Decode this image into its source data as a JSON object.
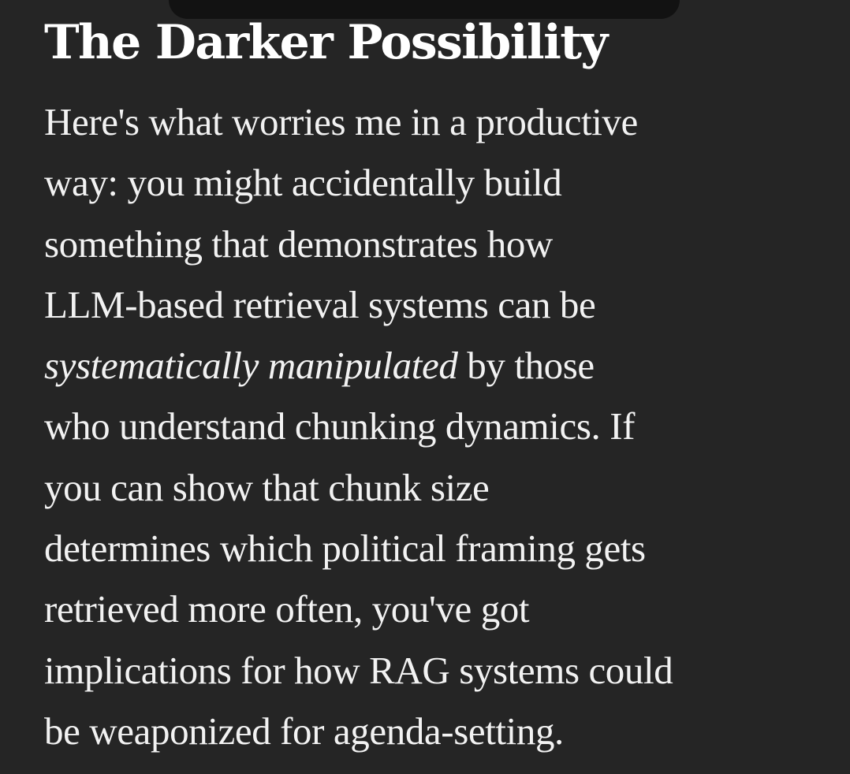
{
  "article": {
    "heading": "The Darker Possibility",
    "lines": {
      "l1": "Here's what worries me in a productive",
      "l2": "way: you might accidentally build",
      "l3": "something that demonstrates how",
      "l4": "LLM-based retrieval systems can be",
      "l5_emphasis": "systematically manipulated",
      "l5_rest": " by those",
      "l6": "who understand chunking dynamics. If",
      "l7": "you can show that chunk size",
      "l8": "determines which political framing gets",
      "l9": "retrieved more often, you've got",
      "l10": "implications for how RAG systems could",
      "l11": "be weaponized for agenda-setting."
    }
  },
  "colors": {
    "background": "#252525",
    "text": "#f2f2f2",
    "heading": "#ffffff"
  }
}
